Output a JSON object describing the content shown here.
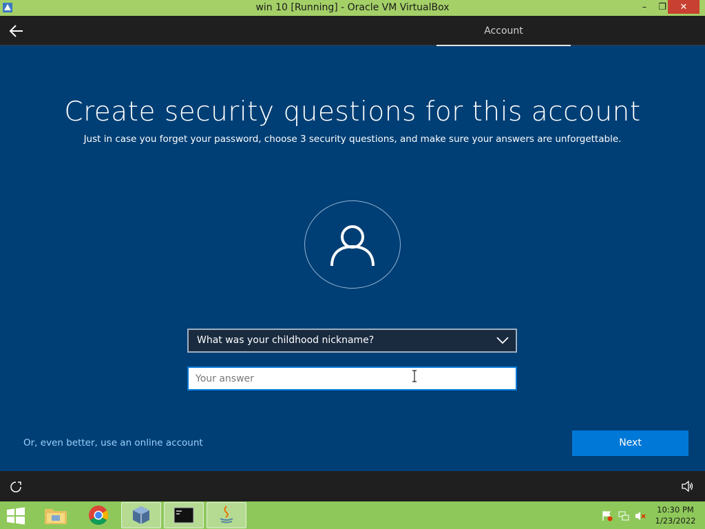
{
  "window": {
    "title": "win 10 [Running] - Oracle VM VirtualBox",
    "minimize": "–",
    "restore": "❐",
    "close": "✕"
  },
  "header": {
    "tab_label": "Account"
  },
  "main": {
    "title": "Create security questions for this account",
    "subtitle": "Just in case you forget your password, choose 3 security questions, and make sure your answers are unforgettable.",
    "question_selected": "What was your childhood nickname?",
    "answer_placeholder": "Your answer",
    "answer_value": "",
    "online_account_link": "Or, even better, use an online account",
    "next_button": "Next"
  },
  "taskbar": {
    "items": [
      "file-explorer",
      "chrome",
      "virtualbox",
      "command-prompt",
      "java"
    ],
    "time": "10:30 PM",
    "date": "1/23/2022"
  },
  "colors": {
    "background": "#003f75",
    "accent": "#0078d7",
    "link": "#9cd0ff",
    "host_titlebar": "#a4d067",
    "host_taskbar": "#8ec85a"
  }
}
